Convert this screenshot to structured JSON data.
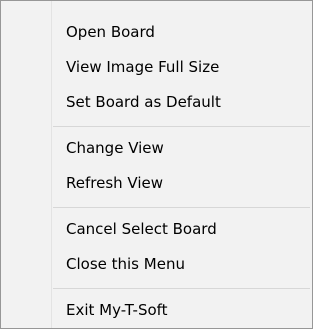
{
  "menu": {
    "groups": [
      {
        "items": [
          "Open Board",
          "View Image Full Size",
          "Set Board as Default"
        ]
      },
      {
        "items": [
          "Change View",
          "Refresh View"
        ]
      },
      {
        "items": [
          "Cancel Select Board",
          "Close this Menu"
        ]
      },
      {
        "items": [
          "Exit My-T-Soft"
        ]
      }
    ]
  }
}
